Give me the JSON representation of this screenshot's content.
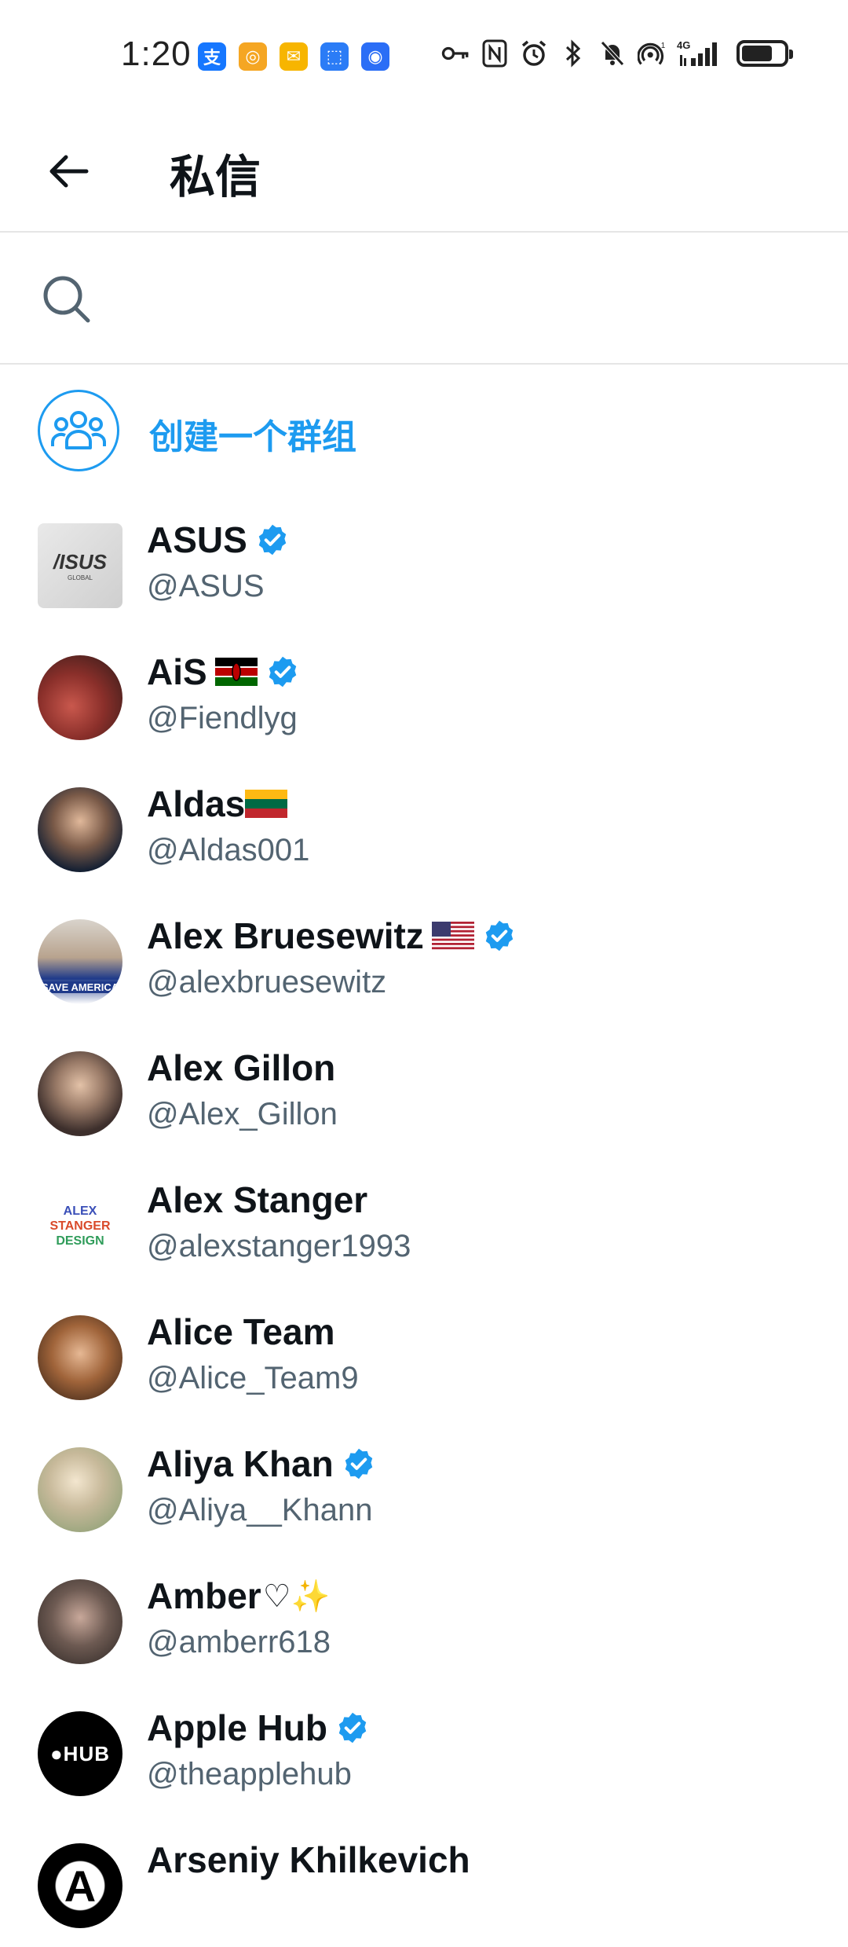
{
  "status_bar": {
    "time": "1:20",
    "apps": [
      {
        "name": "alipay-icon",
        "glyph": "支",
        "color": "#1677ff"
      },
      {
        "name": "app-orange-icon",
        "glyph": "◎",
        "color": "#f5a623"
      },
      {
        "name": "mail-icon",
        "glyph": "✉",
        "color": "#f7b500"
      },
      {
        "name": "bag-app-icon",
        "glyph": "⬚",
        "color": "#2b7cf6"
      },
      {
        "name": "shield-app-icon",
        "glyph": "◉",
        "color": "#2b6ef6"
      }
    ],
    "signal_label": "4G"
  },
  "header": {
    "title": "私信"
  },
  "search": {
    "placeholder": ""
  },
  "create_group": {
    "label": "创建一个群组"
  },
  "accent_color": "#1d9bf0",
  "contacts": [
    {
      "name": "ASUS",
      "handle": "@ASUS",
      "verified": true,
      "flag": "",
      "emoji": "",
      "avatar": "asus-logo"
    },
    {
      "name": "AiS",
      "handle": "@Fiendlyg",
      "verified": true,
      "flag": "kenya",
      "emoji": "",
      "avatar": "photo"
    },
    {
      "name": "Aldas",
      "handle": "@Aldas001",
      "verified": false,
      "flag": "lithuania",
      "emoji": "",
      "avatar": "photo"
    },
    {
      "name": "Alex Bruesewitz",
      "handle": "@alexbruesewitz",
      "verified": true,
      "flag": "usa",
      "emoji": "",
      "avatar": "photo"
    },
    {
      "name": "Alex Gillon",
      "handle": "@Alex_Gillon",
      "verified": false,
      "flag": "",
      "emoji": "",
      "avatar": "photo"
    },
    {
      "name": "Alex Stanger",
      "handle": "@alexstanger1993",
      "verified": false,
      "flag": "",
      "emoji": "",
      "avatar": "stanger-logo"
    },
    {
      "name": "Alice Team",
      "handle": "@Alice_Team9",
      "verified": false,
      "flag": "",
      "emoji": "",
      "avatar": "photo"
    },
    {
      "name": "Aliya Khan",
      "handle": "@Aliya__Khann",
      "verified": true,
      "flag": "",
      "emoji": "",
      "avatar": "photo"
    },
    {
      "name": "Amber",
      "handle": "@amberr618",
      "verified": false,
      "flag": "",
      "emoji": "♡✨",
      "avatar": "photo"
    },
    {
      "name": "Apple Hub",
      "handle": "@theapplehub",
      "verified": true,
      "flag": "",
      "emoji": "",
      "avatar": "applehub-logo"
    },
    {
      "name": "Arseniy Khilkevich",
      "handle": "",
      "verified": false,
      "flag": "",
      "emoji": "",
      "avatar": "photo"
    }
  ],
  "avatar_text": {
    "asus_logo": "/ISUS",
    "asus_sub": "GLOBAL",
    "stanger": [
      "ALEX",
      "STANGER",
      "DESIGN"
    ],
    "applehub": "HUB",
    "bruesewitz_banner": "SAVE AMERICA",
    "arseniy_letter": "A"
  }
}
